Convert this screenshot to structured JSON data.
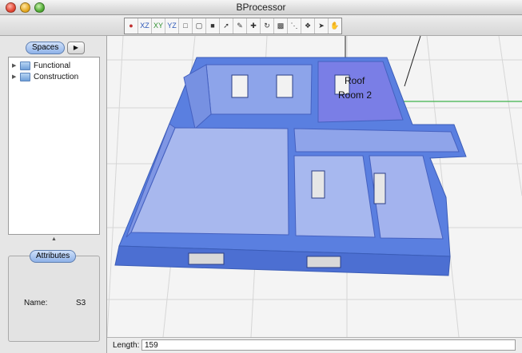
{
  "window": {
    "title": "BProcessor"
  },
  "toolbar": {
    "tools": [
      {
        "icon": "render-mode-icon"
      },
      {
        "icon": "xz-view-icon",
        "text": "XZ"
      },
      {
        "icon": "xy-view-icon",
        "text": "XY"
      },
      {
        "icon": "yz-view-icon",
        "text": "YZ"
      },
      {
        "icon": "box-icon"
      },
      {
        "icon": "box-outline-icon"
      },
      {
        "icon": "box-solid-icon"
      },
      {
        "icon": "select-arrow-icon"
      },
      {
        "icon": "pencil-icon"
      },
      {
        "icon": "move-icon"
      },
      {
        "icon": "rotate-icon"
      },
      {
        "icon": "book-icon"
      },
      {
        "icon": "measure-icon"
      },
      {
        "icon": "compass-icon"
      },
      {
        "icon": "pan-icon"
      },
      {
        "icon": "hand-icon"
      }
    ]
  },
  "sidebar": {
    "spaces_label": "Spaces",
    "tree": [
      {
        "label": "Functional"
      },
      {
        "label": "Construction"
      }
    ],
    "attributes_label": "Attributes",
    "attributes": {
      "name_label": "Name:",
      "name_value": "S3"
    }
  },
  "viewport": {
    "labels": {
      "roof": "Roof",
      "room": "Room 2"
    },
    "colors": {
      "building": "#5b7ee0",
      "selected_room": "#6f78e4",
      "axis_green": "#3fb24a",
      "grid": "#d5d5d5"
    }
  },
  "statusbar": {
    "length_label": "Length:",
    "length_value": "159"
  }
}
